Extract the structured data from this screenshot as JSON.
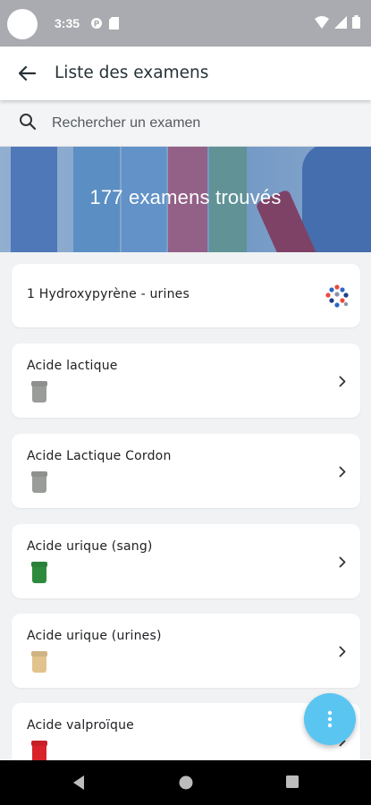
{
  "status_bar": {
    "time": "3:35"
  },
  "header": {
    "title": "Liste des examens"
  },
  "search": {
    "placeholder": "Rechercher un examen"
  },
  "banner": {
    "count_text": "177 examens trouvés"
  },
  "exams": [
    {
      "name": "1 Hydroxypyrène - urines",
      "tube_color": null,
      "icon": "lab-logo-icon"
    },
    {
      "name": "Acide lactique",
      "tube_color": "#9a9c99",
      "icon": "chevron-right-icon"
    },
    {
      "name": "Acide Lactique Cordon",
      "tube_color": "#9a9c99",
      "icon": "chevron-right-icon"
    },
    {
      "name": "Acide urique (sang)",
      "tube_color": "#2e8b3d",
      "icon": "chevron-right-icon"
    },
    {
      "name": "Acide urique (urines)",
      "tube_color": "#e2c38e",
      "icon": "chevron-right-icon"
    },
    {
      "name": "Acide valproïque",
      "tube_color": "#d8232a",
      "icon": "chevron-right-icon"
    }
  ],
  "colors": {
    "accent": "#5bc5f2",
    "status_bar": "#a9abb0",
    "background": "#f1f2f4"
  }
}
